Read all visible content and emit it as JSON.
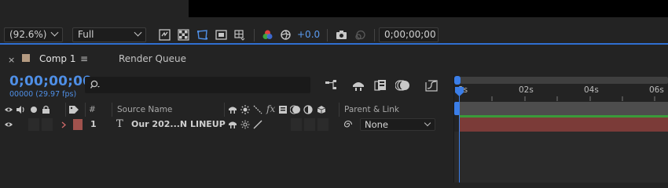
{
  "viewer": {
    "zoom": "(92.6%)",
    "resolution": "Full",
    "exposure": "+0.0",
    "timecode_field": "0;00;00;00"
  },
  "tabs": {
    "close": "×",
    "comp": "Comp 1",
    "menu": "≡",
    "render_queue": "Render Queue"
  },
  "timeline": {
    "timecode": "0;00;00;00",
    "frames": "00000 (29.97 fps)",
    "ruler": [
      "0s",
      "02s",
      "04s",
      "06s"
    ]
  },
  "columns": {
    "number": "#",
    "source_name": "Source Name",
    "fx": "fx",
    "parent_link": "Parent & Link"
  },
  "layers": [
    {
      "number": "1",
      "type": "T",
      "name": "Our 202...N LINEUP",
      "parent": "None",
      "label_color": "#a0524d"
    }
  ],
  "colors": {
    "accent": "#3b7ee8",
    "layer_bar": "#7b3b38",
    "timecode": "#4f8fe6"
  }
}
